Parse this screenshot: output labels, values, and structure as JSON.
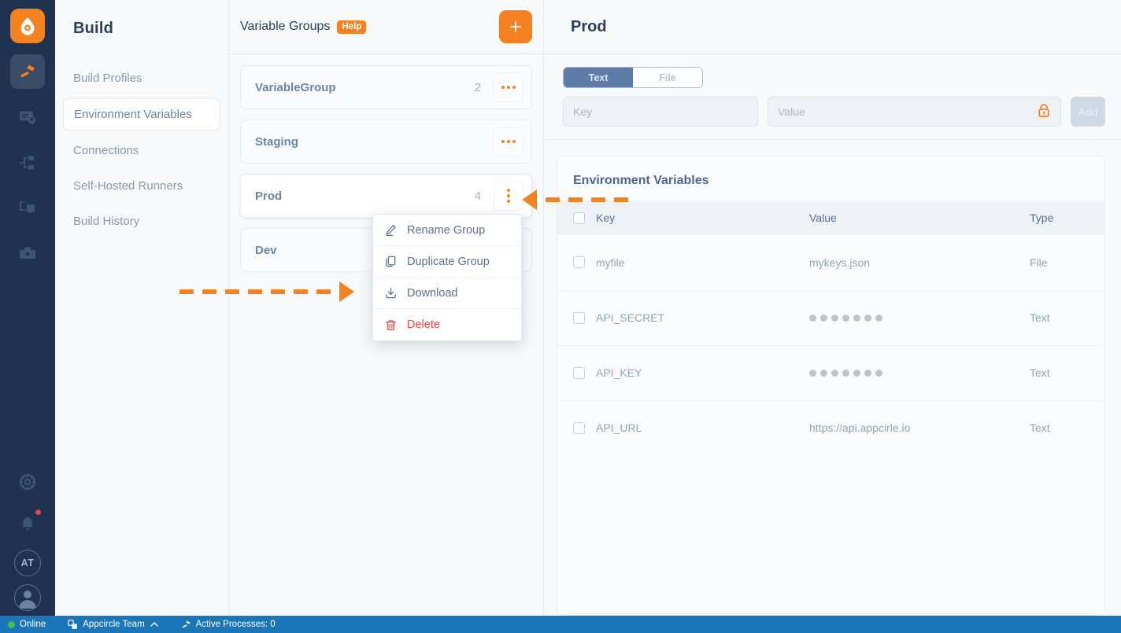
{
  "rail": {
    "logo_icon": "appcircle-logo-icon",
    "items": [
      {
        "icon": "hammer-build-icon",
        "active": true
      },
      {
        "icon": "certificate-signing-icon",
        "active": false
      },
      {
        "icon": "distribution-icon",
        "active": false
      },
      {
        "icon": "testing-distribution-icon",
        "active": false
      },
      {
        "icon": "toolbox-store-icon",
        "active": false
      }
    ],
    "bottom": [
      {
        "icon": "settings-gear-icon"
      },
      {
        "icon": "notification-bell-icon",
        "has_badge": true
      },
      {
        "icon": "organization-initials",
        "label": "AT"
      },
      {
        "icon": "user-avatar-icon"
      }
    ]
  },
  "nav": {
    "title": "Build",
    "items": [
      {
        "label": "Build Profiles",
        "selected": false
      },
      {
        "label": "Environment Variables",
        "selected": true
      },
      {
        "label": "Connections",
        "selected": false
      },
      {
        "label": "Self-Hosted Runners",
        "selected": false
      },
      {
        "label": "Build History",
        "selected": false
      }
    ]
  },
  "groups": {
    "title": "Variable Groups",
    "help_label": "Help",
    "add_label": "+",
    "items": [
      {
        "name": "VariableGroup",
        "count": "2",
        "active": false,
        "menu_icon": "more-horizontal-icon"
      },
      {
        "name": "Staging",
        "count": "",
        "active": false,
        "menu_icon": "more-horizontal-icon"
      },
      {
        "name": "Prod",
        "count": "4",
        "active": true,
        "menu_icon": "more-vertical-icon"
      },
      {
        "name": "Dev",
        "count": "",
        "active": false,
        "menu_icon": "more-horizontal-icon"
      }
    ]
  },
  "context_menu": {
    "items": [
      {
        "label": "Rename Group",
        "icon": "pencil-edit-icon",
        "danger": false
      },
      {
        "label": "Duplicate Group",
        "icon": "copy-duplicate-icon",
        "danger": false
      },
      {
        "label": "Download",
        "icon": "download-icon",
        "danger": false
      },
      {
        "label": "Delete",
        "icon": "trash-delete-icon",
        "danger": true
      }
    ]
  },
  "detail": {
    "title": "Prod",
    "tabs": [
      {
        "label": "Text",
        "active": true
      },
      {
        "label": "File",
        "active": false
      }
    ],
    "key_placeholder": "Key",
    "key_value": "",
    "value_placeholder": "Value",
    "value_value": "",
    "lock_icon": "lock-secret-icon",
    "add_button": "Add",
    "table": {
      "title": "Environment Variables",
      "columns": [
        "Key",
        "Value",
        "Type"
      ],
      "rows": [
        {
          "key": "myfile",
          "value": "mykeys.json",
          "masked": false,
          "type": "File"
        },
        {
          "key": "API_SECRET",
          "value": "",
          "masked": true,
          "mask_count": 7,
          "type": "Text"
        },
        {
          "key": "API_KEY",
          "value": "",
          "masked": true,
          "mask_count": 7,
          "type": "Text"
        },
        {
          "key": "API_URL",
          "value": "https://api.appcirle.io",
          "masked": false,
          "type": "Text"
        }
      ]
    }
  },
  "statusbar": {
    "online_label": "Online",
    "team_label": "Appcircle Team",
    "team_chevron": "chevron-up-icon",
    "processes_label": "Active Processes: 0",
    "processes_icon": "hammer-build-icon",
    "team_icon": "switch-organization-icon"
  },
  "colors": {
    "accent_orange": "#f58220",
    "rail_navy": "#1f3250",
    "status_blue": "#1b76b8",
    "danger_red": "#ef4444",
    "tab_active": "#5d7ba6"
  }
}
